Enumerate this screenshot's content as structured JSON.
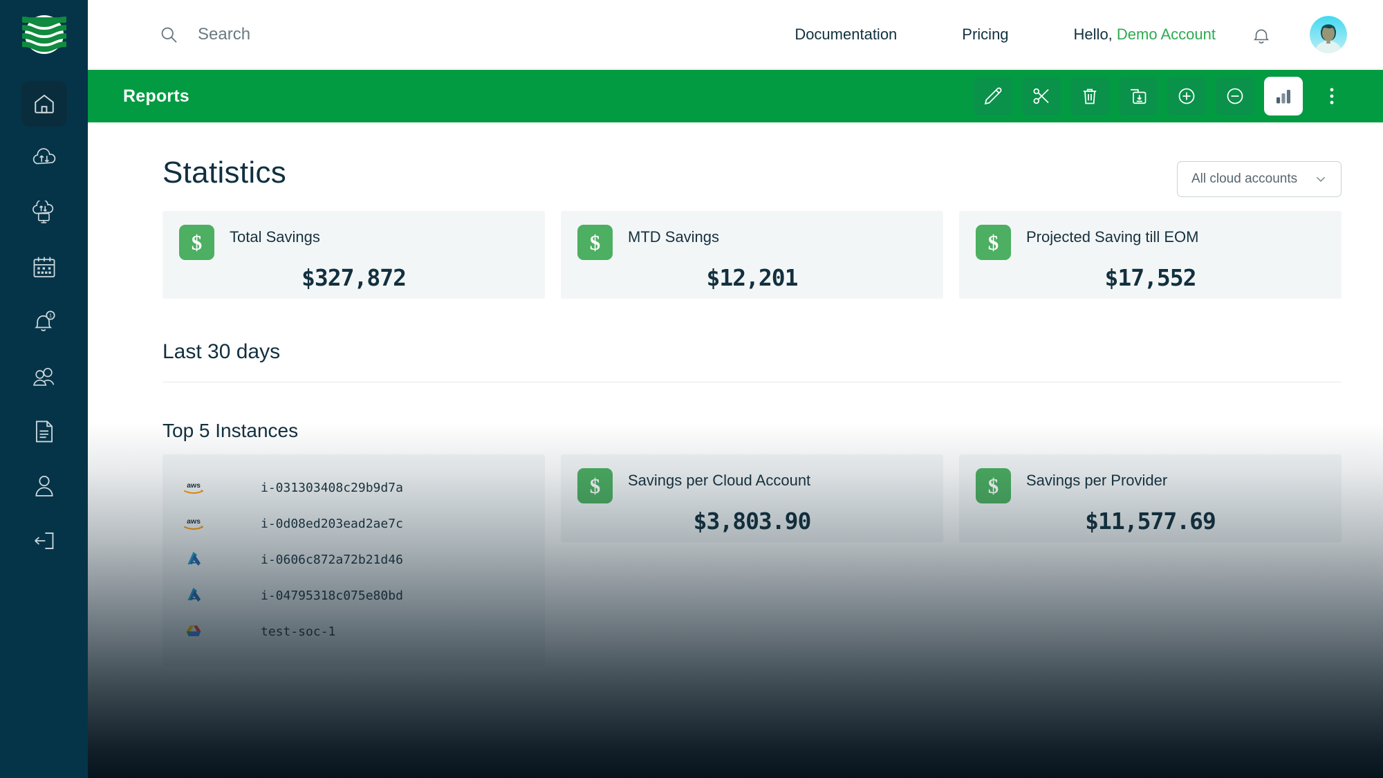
{
  "brand": {
    "logo_name": "cloud-stripes-logo",
    "accent_green": "#029b42",
    "badge_green": "#4caf61",
    "sidebar_navy": "#053448",
    "text_navy": "#12303f"
  },
  "topbar": {
    "search": {
      "placeholder": "Search",
      "value": "",
      "icon": "search-icon"
    },
    "links": [
      {
        "label": "Documentation"
      },
      {
        "label": "Pricing"
      }
    ],
    "greeting_prefix": "Hello,",
    "account_name": "Demo Account",
    "bell_icon": "bell-icon",
    "avatar_name": "user-avatar"
  },
  "toolbar": {
    "title": "Reports",
    "tools": [
      {
        "name": "edit-button",
        "icon": "pencil-icon",
        "active": false
      },
      {
        "name": "cut-button",
        "icon": "scissors-icon",
        "active": false
      },
      {
        "name": "delete-button",
        "icon": "trash-icon",
        "active": false
      },
      {
        "name": "save-button",
        "icon": "save-download-icon",
        "active": false
      },
      {
        "name": "add-button",
        "icon": "plus-circle-icon",
        "active": false
      },
      {
        "name": "remove-button",
        "icon": "minus-circle-icon",
        "active": false
      },
      {
        "name": "statistics-button",
        "icon": "bar-chart-icon",
        "active": true
      },
      {
        "name": "more-options-button",
        "icon": "vertical-dots-icon",
        "active": false
      }
    ]
  },
  "sidebar": {
    "items": [
      {
        "name": "sidebar-item-home",
        "icon": "home-icon",
        "active": true,
        "badge": ""
      },
      {
        "name": "sidebar-item-cloud-transfer",
        "icon": "cloud-transfer-icon",
        "active": false,
        "badge": ""
      },
      {
        "name": "sidebar-item-cloud-instances",
        "icon": "cloud-monitor-icon",
        "active": false,
        "badge": ""
      },
      {
        "name": "sidebar-item-schedules",
        "icon": "calendar-icon",
        "active": false,
        "badge": ""
      },
      {
        "name": "sidebar-item-notifications",
        "icon": "bell-badge-icon",
        "active": false,
        "badge": "1"
      },
      {
        "name": "sidebar-item-teams",
        "icon": "users-icon",
        "active": false,
        "badge": ""
      },
      {
        "name": "sidebar-item-reports",
        "icon": "document-icon",
        "active": false,
        "badge": ""
      },
      {
        "name": "sidebar-item-profile",
        "icon": "user-icon",
        "active": false,
        "badge": ""
      },
      {
        "name": "sidebar-item-logout",
        "icon": "logout-icon",
        "active": false,
        "badge": ""
      }
    ]
  },
  "main": {
    "page_title": "Statistics",
    "account_filter": {
      "value": "All cloud accounts",
      "icon": "chevron-down-icon"
    },
    "stat_cards": [
      {
        "name": "total-savings-card",
        "label": "Total Savings",
        "value": "$327,872",
        "icon": "dollar-icon"
      },
      {
        "name": "mtd-savings-card",
        "label": "MTD Savings",
        "value": "$12,201",
        "icon": "dollar-icon"
      },
      {
        "name": "projected-savings-card",
        "label": "Projected Saving till EOM",
        "value": "$17,552",
        "icon": "dollar-icon"
      }
    ],
    "period_title": "Last 30 days",
    "top_instances_title": "Top 5 Instances",
    "instances": [
      {
        "provider": "aws",
        "provider_icon": "aws-logo-icon",
        "id": "i-031303408c29b9d7a"
      },
      {
        "provider": "aws",
        "provider_icon": "aws-logo-icon",
        "id": "i-0d08ed203ead2ae7c"
      },
      {
        "provider": "azure",
        "provider_icon": "azure-logo-icon",
        "id": "i-0606c872a72b21d46"
      },
      {
        "provider": "azure",
        "provider_icon": "azure-logo-icon",
        "id": "i-04795318c075e80bd"
      },
      {
        "provider": "gcp",
        "provider_icon": "gcp-logo-icon",
        "id": "test-soc-1"
      }
    ],
    "secondary_cards": [
      {
        "name": "savings-per-cloud-account-card",
        "label": "Savings per Cloud Account",
        "value": "$3,803.90",
        "icon": "dollar-icon"
      },
      {
        "name": "savings-per-provider-card",
        "label": "Savings per Provider",
        "value": "$11,577.69",
        "icon": "dollar-icon"
      }
    ]
  }
}
